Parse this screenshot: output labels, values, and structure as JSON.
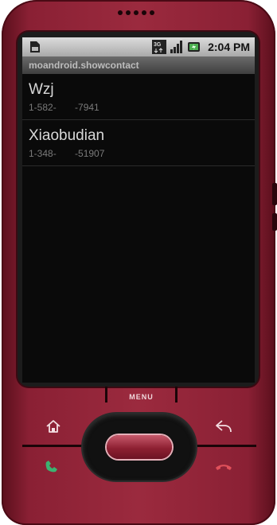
{
  "statusbar": {
    "time": "2:04 PM",
    "icons": [
      "sim-icon",
      "3g-icon",
      "signal-icon",
      "battery-icon"
    ]
  },
  "app": {
    "title": "moandroid.showcontact"
  },
  "contacts": [
    {
      "name": "Wzj",
      "phone": "1-582-       -7941"
    },
    {
      "name": "Xiaobudian",
      "phone": "1-348-       -51907"
    }
  ],
  "hardware": {
    "menu_label": "MENU"
  },
  "colors": {
    "phone_body": "#9b2a3e",
    "screen_bg": "#0a0a0a",
    "call_green": "#3cb371",
    "end_red": "#e0505a"
  }
}
